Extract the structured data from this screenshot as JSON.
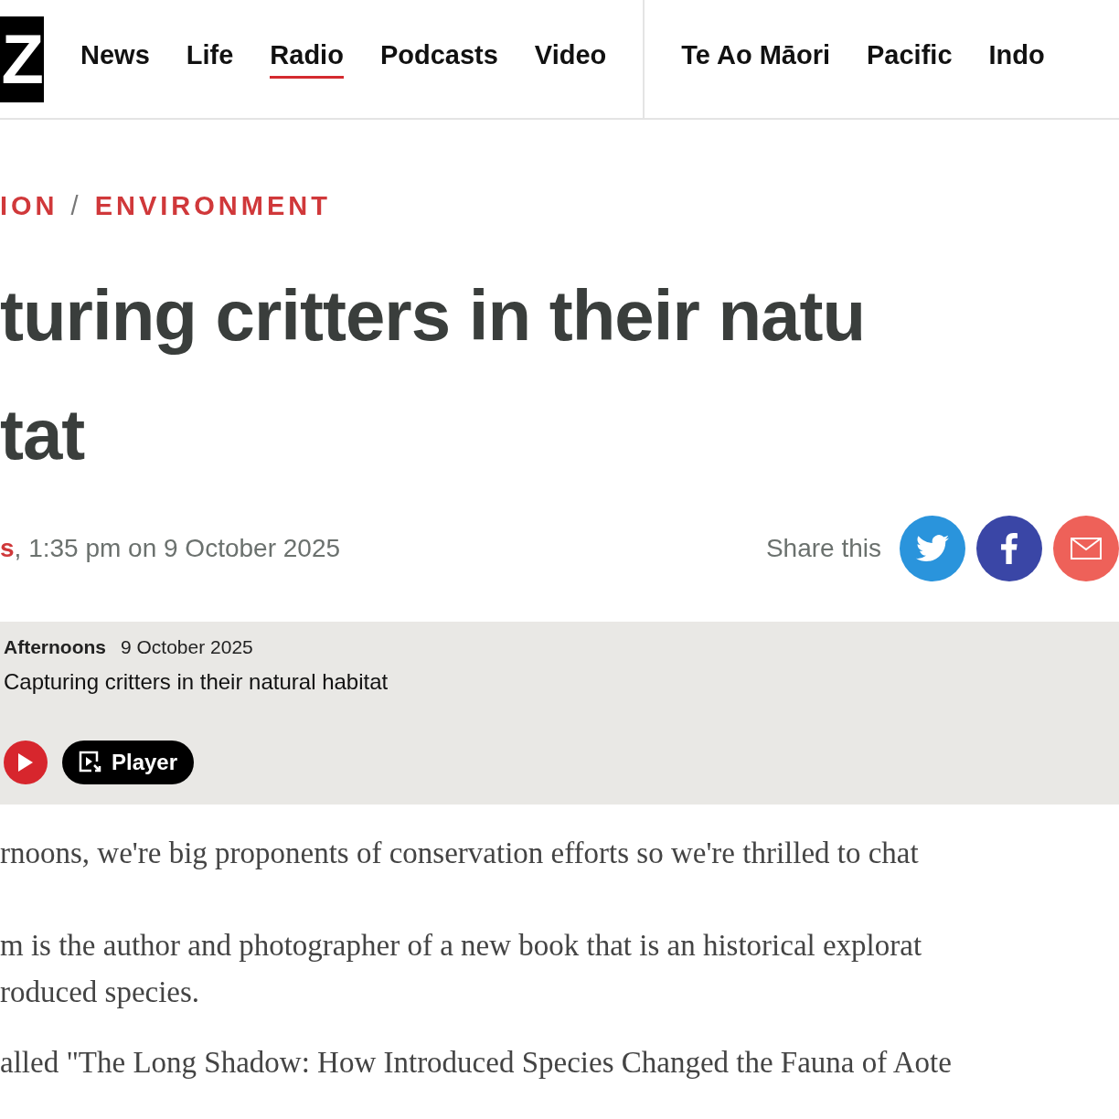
{
  "logo": {
    "text": "Z"
  },
  "nav": {
    "primary": [
      {
        "label": "News",
        "selected": false
      },
      {
        "label": "Life",
        "selected": false
      },
      {
        "label": "Radio",
        "selected": true
      },
      {
        "label": "Podcasts",
        "selected": false
      },
      {
        "label": "Video",
        "selected": false
      }
    ],
    "secondary": [
      {
        "label": "Te Ao Māori",
        "selected": false
      },
      {
        "label": "Pacific",
        "selected": false
      },
      {
        "label": "Indo",
        "selected": false
      }
    ]
  },
  "breadcrumb": [
    "ION",
    "ENVIRONMENT"
  ],
  "breadcrumb_separator": "/",
  "headline_lines": [
    "turing critters in their natu",
    "tat"
  ],
  "byline": {
    "author": "s",
    "date": ", 1:35 pm on 9 October 2025"
  },
  "share": {
    "label": "Share this",
    "buttons": [
      {
        "kind": "twitter",
        "color": "#2a94dc"
      },
      {
        "kind": "facebook",
        "color": "#3a46a6"
      },
      {
        "kind": "email",
        "color": "#ee6159"
      }
    ]
  },
  "audio": {
    "programme": "Afternoons",
    "date": "9 October 2025",
    "title": "Capturing critters in their natural habitat",
    "player_label": "Player"
  },
  "paragraphs": [
    [
      "rnoons, we're big proponents of conservation efforts so we're thrilled to chat"
    ],
    [
      "m is the author and photographer of a new book that is an historical explorat",
      "roduced species."
    ],
    [
      "alled \"The Long Shadow: How Introduced Species Changed the Fauna of Aote"
    ]
  ]
}
